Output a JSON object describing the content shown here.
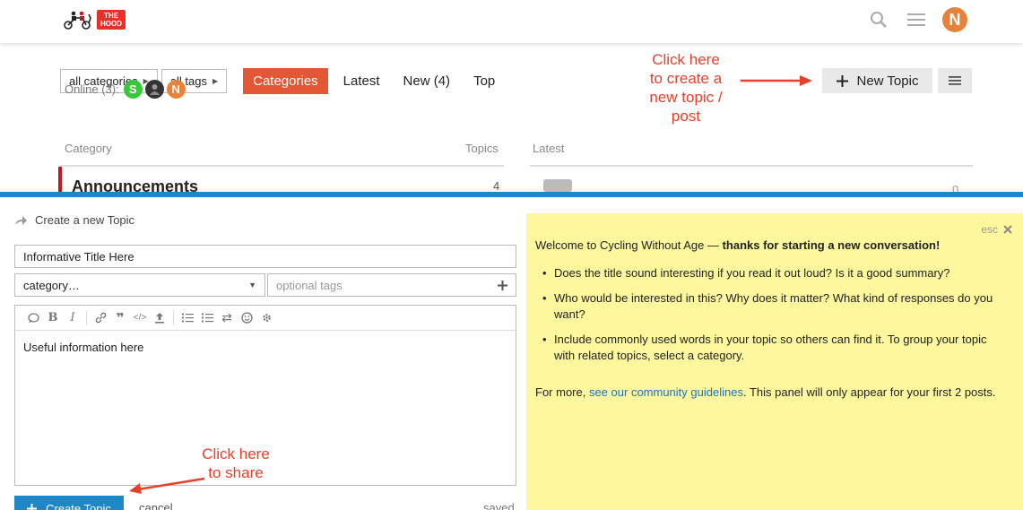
{
  "header": {
    "logo_text_line1": "THE",
    "logo_text_line2": "HOOD",
    "avatar_letter": "N"
  },
  "nav": {
    "all_categories": "all categories",
    "all_tags": "all tags",
    "tabs": [
      "Categories",
      "Latest",
      "New (4)",
      "Top"
    ],
    "active_tab": "Categories"
  },
  "online": {
    "label": "Online (3):",
    "users": [
      {
        "letter": "S",
        "color": "#3bc63b"
      },
      {
        "letter": "",
        "color": "#333333"
      },
      {
        "letter": "N",
        "color": "#e8823a"
      }
    ]
  },
  "actions": {
    "new_topic_label": "New Topic"
  },
  "category_table": {
    "col_category": "Category",
    "col_topics": "Topics",
    "col_latest": "Latest",
    "row": {
      "name": "Announcements",
      "topics": "4",
      "latest_count": "0"
    }
  },
  "annotations": {
    "new_topic_note": [
      "Click here",
      "to create a",
      "new topic /",
      "post"
    ],
    "share_note": [
      "Click here",
      "to share"
    ]
  },
  "composer": {
    "title": "Create a new Topic",
    "title_value": "Informative Title Here",
    "category_value": "category…",
    "tags_placeholder": "optional tags",
    "body_text": "Useful information here",
    "create_label": "Create Topic",
    "cancel_label": "cancel",
    "status": "saved"
  },
  "help_panel": {
    "esc_label": "esc",
    "intro": "Welcome to Cycling Without Age — ",
    "intro_bold": "thanks for starting a new conversation!",
    "tips": [
      "Does the title sound interesting if you read it out loud? Is it a good summary?",
      "Who would be interested in this? Why does it matter? What kind of responses do you want?",
      "Include commonly used words in your topic so others can find it. To group your topic with related topics, select a category."
    ],
    "footer_before": "For more, ",
    "footer_link": "see our community guidelines",
    "footer_after": ". This panel will only appear for your first 2 posts."
  },
  "colors": {
    "accent": "#e45735",
    "composer_blue": "#1d87c8",
    "help_bg": "#fdf79e",
    "annotation_red": "#e8402b"
  }
}
